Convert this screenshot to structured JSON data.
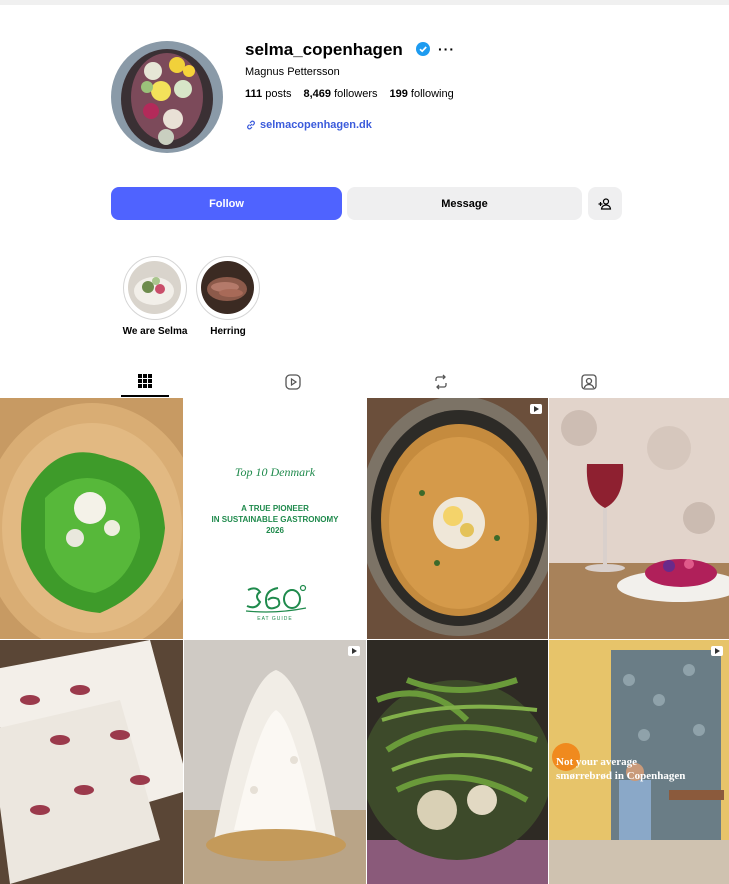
{
  "profile": {
    "username": "selma_copenhagen",
    "full_name": "Magnus Pettersson",
    "more_label": "···",
    "stats": {
      "posts_count": "111",
      "posts_label": "posts",
      "followers_count": "8,469",
      "followers_label": "followers",
      "following_count": "199",
      "following_label": "following"
    },
    "website": "selmacopenhagen.dk"
  },
  "actions": {
    "follow_label": "Follow",
    "message_label": "Message"
  },
  "highlights": [
    {
      "label": "We are Selma"
    },
    {
      "label": "Herring"
    }
  ],
  "tabs": [
    "posts-icon",
    "reels-icon",
    "reposts-icon",
    "tagged-icon"
  ],
  "posts": {
    "p2": {
      "heading": "Top 10 Denmark",
      "line1": "A TRUE PIONEER",
      "line2": "IN SUSTAINABLE GASTRONOMY",
      "year": "2026",
      "logo_caption": "EAT GUIDE"
    },
    "p8": {
      "line1": "Not your average",
      "line2": "smørrebrød in Copenhagen"
    }
  },
  "colors": {
    "primary": "#4f63ff",
    "link": "#3b5bdb",
    "verified": "#1d9bf0",
    "tile_green": "#1f8a4c"
  }
}
